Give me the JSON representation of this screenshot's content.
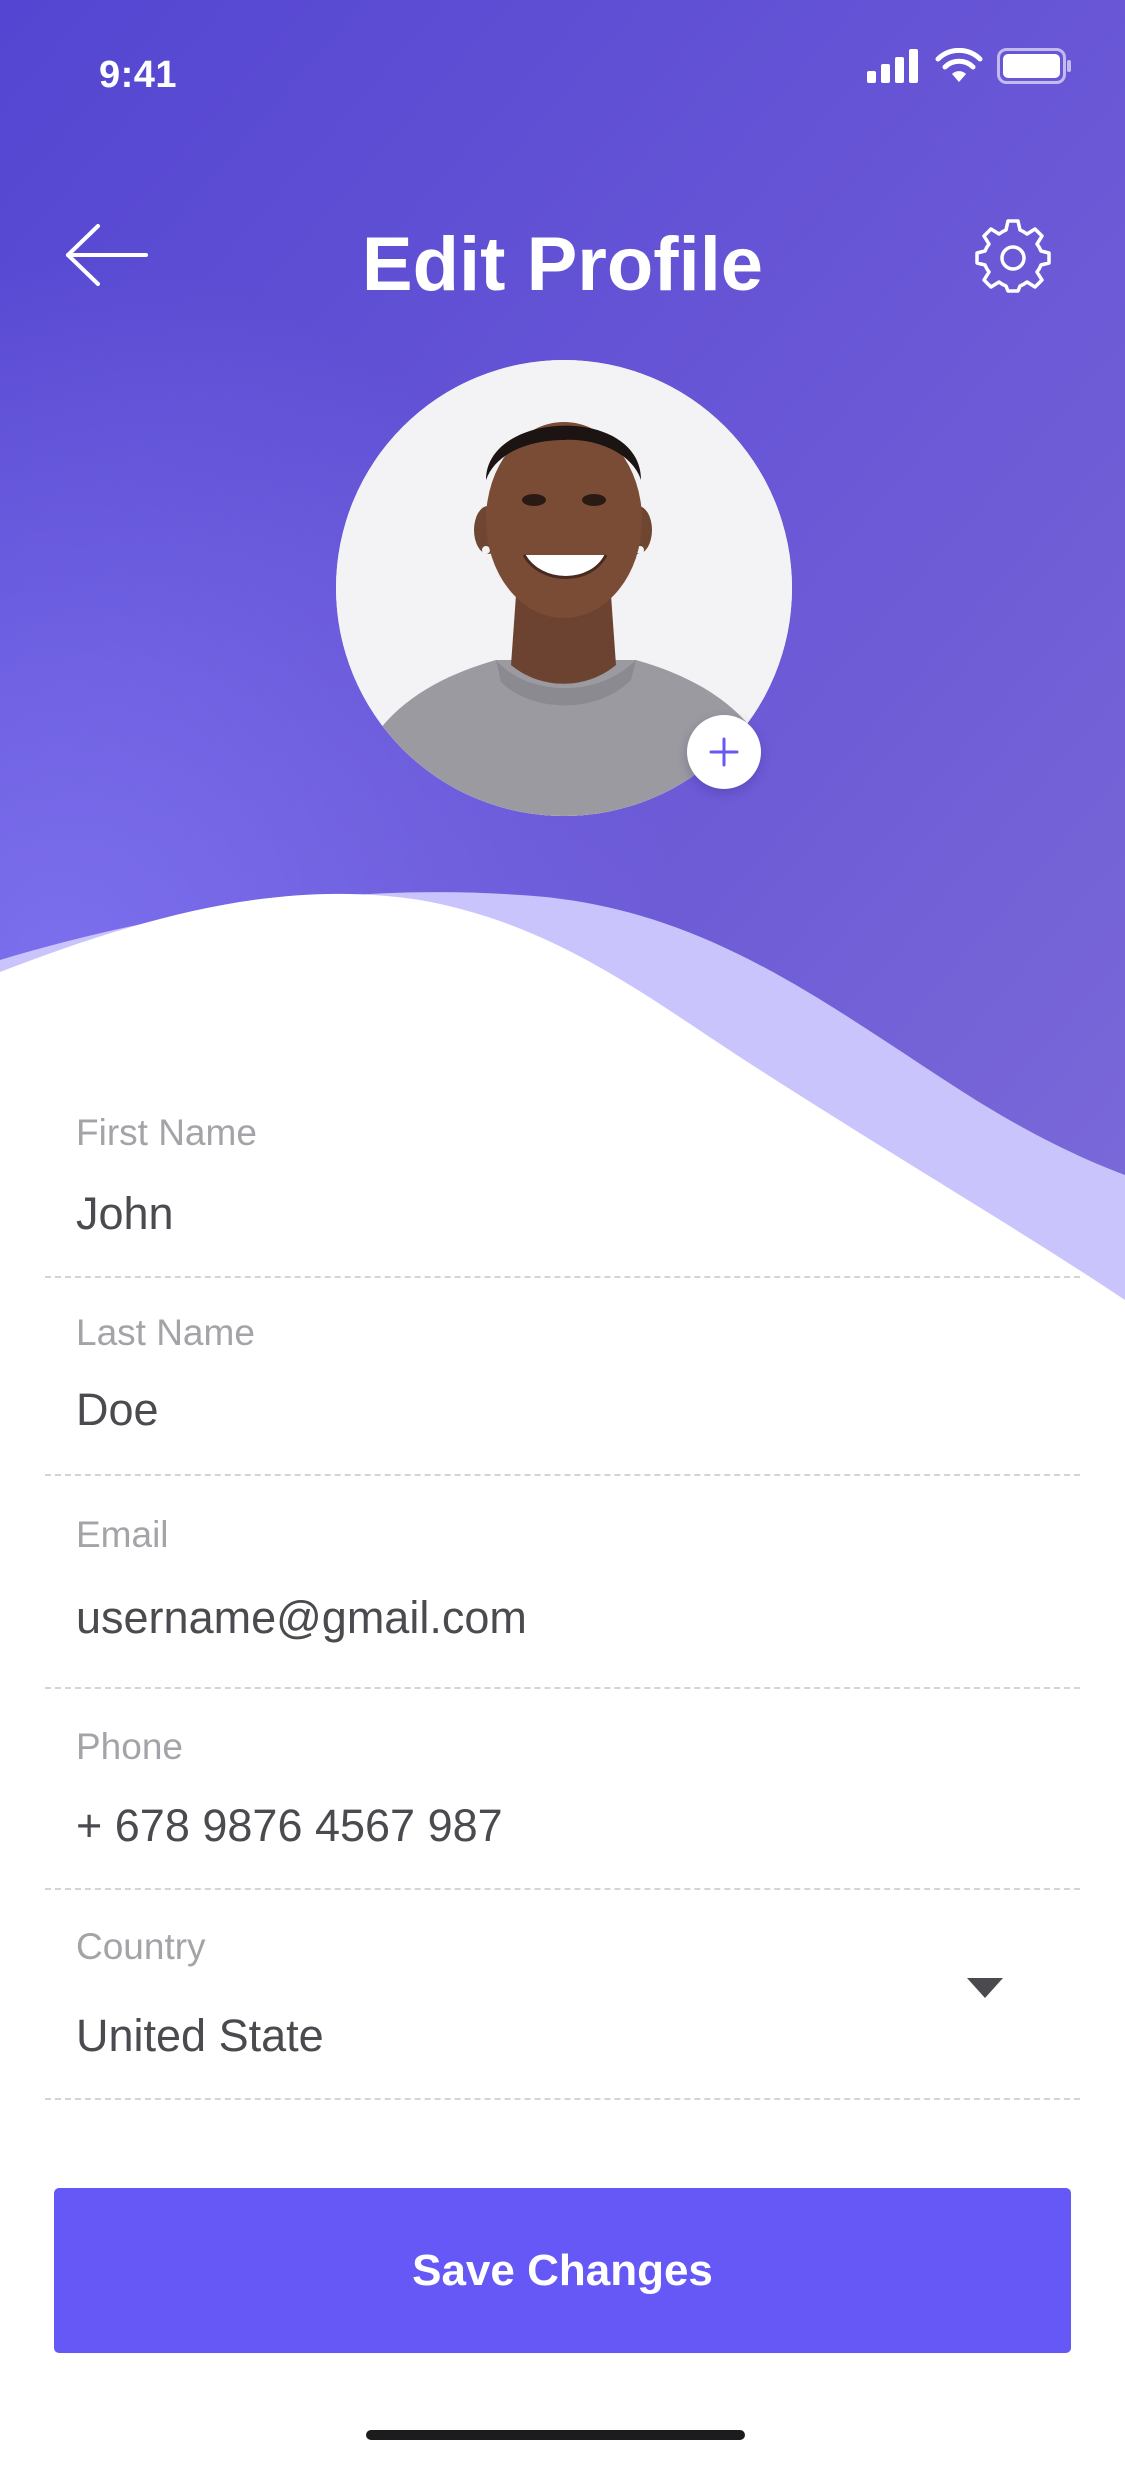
{
  "status_bar": {
    "time": "9:41"
  },
  "header": {
    "title": "Edit Profile",
    "back_icon": "arrow-left-icon",
    "settings_icon": "gear-icon"
  },
  "avatar": {
    "add_icon": "plus-icon"
  },
  "form": {
    "fields": [
      {
        "label": "First Name",
        "value": "John"
      },
      {
        "label": "Last Name",
        "value": "Doe"
      },
      {
        "label": "Email",
        "value": "username@gmail.com"
      },
      {
        "label": "Phone",
        "value": "+ 678 9876 4567 987"
      },
      {
        "label": "Country",
        "value": "United State"
      }
    ]
  },
  "actions": {
    "save_label": "Save Changes"
  },
  "colors": {
    "primary": "#6558f6",
    "header_gradient_start": "#5a4bd6",
    "header_gradient_end": "#7466d8",
    "wave_light": "#c9c4fb",
    "label_gray": "#a3a3a8",
    "value_gray": "#4a4a4f"
  }
}
